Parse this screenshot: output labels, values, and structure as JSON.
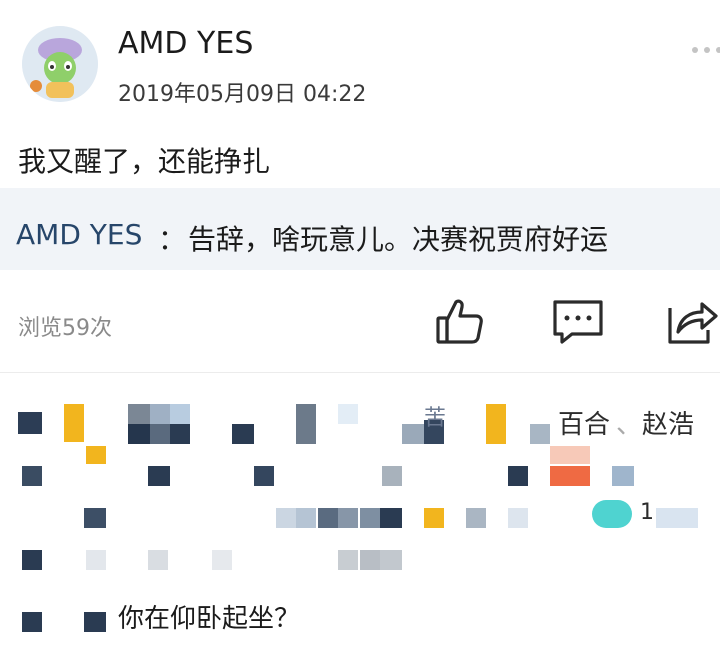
{
  "post": {
    "username": "AMD YES",
    "time": "2019年05月09日 04:22",
    "text": "我又醒了，还能挣扎",
    "quote": {
      "author": "AMD YES",
      "separator": "：",
      "text": "告辞，啥玩意儿。决赛祝贾府好运"
    },
    "views": "浏览59次",
    "actions": [
      "like-icon",
      "comment-icon",
      "share-icon"
    ]
  },
  "likes_row": {
    "visible_fragments": [
      "百合",
      "、",
      "赵浩"
    ]
  },
  "comment": {
    "visible_text": "你在仰卧起坐？"
  },
  "colors": {
    "quote_author": "#27466a",
    "quote_bg": "#f1f4f8",
    "muted": "#8a8a8a"
  }
}
